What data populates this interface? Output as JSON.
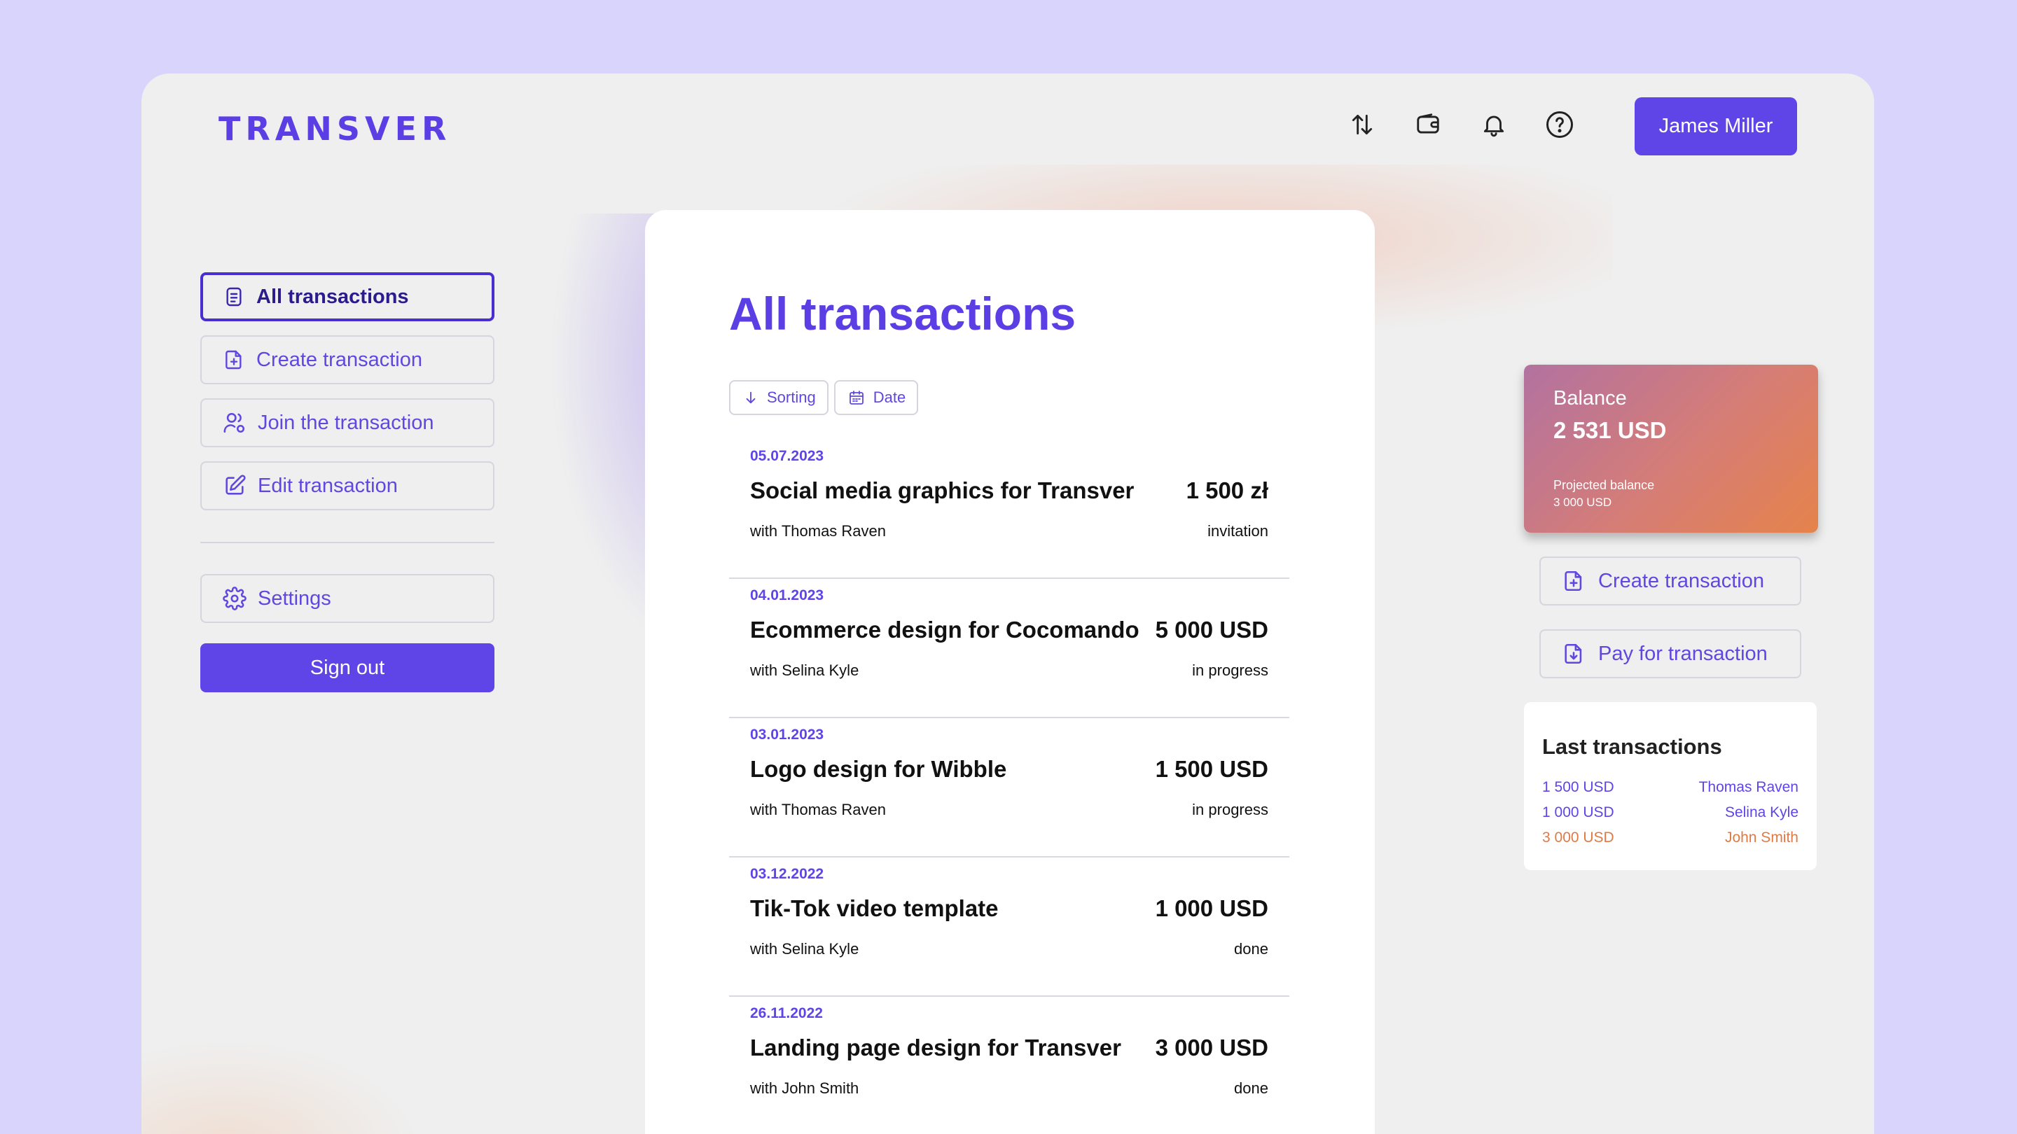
{
  "header": {
    "logo": "TRANSVER",
    "user_name": "James Miller",
    "icons": [
      "transfer-arrows-icon",
      "wallet-icon",
      "bell-icon",
      "help-icon"
    ]
  },
  "sidebar": {
    "items": [
      {
        "label": "All transactions",
        "icon": "document-icon",
        "active": true
      },
      {
        "label": "Create transaction",
        "icon": "file-plus-icon",
        "active": false
      },
      {
        "label": "Join the transaction",
        "icon": "users-icon",
        "active": false
      },
      {
        "label": "Edit transaction",
        "icon": "edit-icon",
        "active": false
      }
    ],
    "settings_label": "Settings",
    "signout_label": "Sign out"
  },
  "main": {
    "title": "All transactions",
    "filters": {
      "sorting": "Sorting",
      "date": "Date"
    },
    "transactions": [
      {
        "date": "05.07.2023",
        "title": "Social media graphics for Transver",
        "amount": "1 500 zł",
        "with": "with Thomas Raven",
        "status": "invitation"
      },
      {
        "date": "04.01.2023",
        "title": "Ecommerce design for Cocomando",
        "amount": "5 000 USD",
        "with": "with Selina Kyle",
        "status": "in progress"
      },
      {
        "date": "03.01.2023",
        "title": "Logo design for Wibble",
        "amount": "1 500 USD",
        "with": "with Thomas Raven",
        "status": "in progress"
      },
      {
        "date": "03.12.2022",
        "title": "Tik-Tok video template",
        "amount": "1 000 USD",
        "with": "with Selina Kyle",
        "status": "done"
      },
      {
        "date": "26.11.2022",
        "title": "Landing page design for Transver",
        "amount": "3 000 USD",
        "with": "with John Smith",
        "status": "done"
      }
    ]
  },
  "right": {
    "balance": {
      "label": "Balance",
      "value": "2 531 USD",
      "projected_label": "Projected balance",
      "projected_value": "3 000 USD"
    },
    "create_label": "Create transaction",
    "pay_label": "Pay for transaction",
    "last": {
      "title": "Last transactions",
      "rows": [
        {
          "amount": "1 500 USD",
          "name": "Thomas Raven",
          "color": "#5f44e8"
        },
        {
          "amount": "1 000 USD",
          "name": "Selina Kyle",
          "color": "#5f44e8"
        },
        {
          "amount": "3 000 USD",
          "name": "John Smith",
          "color": "#e07a45"
        }
      ]
    }
  },
  "colors": {
    "accent": "#5f44e8",
    "active_border": "#4a2fd0",
    "orange": "#e07a45"
  }
}
